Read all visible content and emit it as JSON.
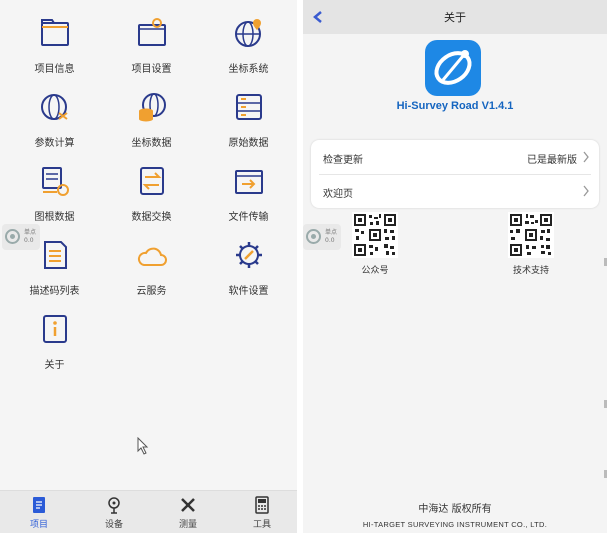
{
  "left_panel": {
    "menu_items": [
      {
        "label": "项目信息",
        "icon": "folder-icon"
      },
      {
        "label": "项目设置",
        "icon": "folder-settings-icon"
      },
      {
        "label": "坐标系统",
        "icon": "globe-location-icon"
      },
      {
        "label": "参数计算",
        "icon": "globe-parameter-icon"
      },
      {
        "label": "坐标数据",
        "icon": "globe-database-icon"
      },
      {
        "label": "原始数据",
        "icon": "raw-data-icon"
      },
      {
        "label": "图根数据",
        "icon": "control-data-icon"
      },
      {
        "label": "数据交换",
        "icon": "data-exchange-icon"
      },
      {
        "label": "文件传输",
        "icon": "file-transfer-icon"
      },
      {
        "label": "描述码列表",
        "icon": "code-list-icon"
      },
      {
        "label": "云服务",
        "icon": "cloud-icon"
      },
      {
        "label": "软件设置",
        "icon": "gear-icon"
      },
      {
        "label": "关于",
        "icon": "info-icon"
      }
    ],
    "float_widget": {
      "line1": "单点",
      "line2": "0.0"
    },
    "bottom_nav": [
      {
        "label": "项目",
        "icon": "project-icon",
        "active": true
      },
      {
        "label": "设备",
        "icon": "device-icon",
        "active": false
      },
      {
        "label": "测量",
        "icon": "survey-icon",
        "active": false
      },
      {
        "label": "工具",
        "icon": "tools-icon",
        "active": false
      }
    ]
  },
  "right_panel": {
    "title": "关于",
    "app_name": "Hi-Survey Road V1.4.1",
    "rows": [
      {
        "label": "检查更新",
        "value": "已是最新版"
      },
      {
        "label": "欢迎页",
        "value": ""
      }
    ],
    "qr_codes": [
      {
        "label": "公众号"
      },
      {
        "label": "技术支持"
      }
    ],
    "float_widget": {
      "line1": "单点",
      "line2": "0.0"
    },
    "copyright": "中海达 版权所有",
    "company": "HI-TARGET SURVEYING INSTRUMENT CO., LTD."
  },
  "colors": {
    "icon_primary": "#2a3a8c",
    "icon_accent": "#f0a030",
    "nav_active": "#2b5bd7",
    "brand_blue": "#1565c0"
  }
}
